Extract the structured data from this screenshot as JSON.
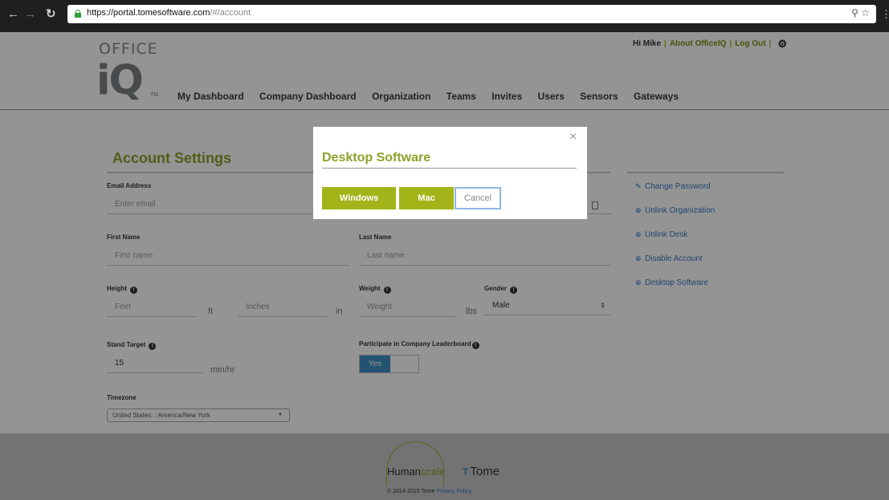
{
  "browser": {
    "url_host": "https://portal.tomesoftware.com",
    "url_path": "/#/account",
    "icons": [
      "back-icon",
      "forward-icon",
      "reload-icon",
      "lock-icon",
      "extension-icon",
      "star-icon",
      "menu-icon"
    ]
  },
  "header": {
    "logo_word": "OFFICE",
    "logo_mark": "iQ",
    "logo_tm": "TM",
    "greeting": "Hi Mike",
    "sep": "|",
    "about_label": "About OfficeIQ",
    "logout_label": "Log Out",
    "nav": [
      "My Dashboard",
      "Company Dashboard",
      "Organization",
      "Teams",
      "Invites",
      "Users",
      "Sensors",
      "Gateways"
    ]
  },
  "account": {
    "title": "Account Settings",
    "email_label": "Email Address",
    "email_placeholder": "Enter email",
    "first_name_label": "First Name",
    "first_name_placeholder": "First name",
    "last_name_label": "Last Name",
    "last_name_placeholder": "Last name",
    "height_label": "Height",
    "feet_placeholder": "Feet",
    "ft_unit": "ft",
    "inches_placeholder": "Inches",
    "in_unit": "in",
    "weight_label": "Weight",
    "weight_placeholder": "Weight",
    "lbs_unit": "lbs",
    "gender_label": "Gender",
    "gender_value": "Male",
    "stand_target_label": "Stand Target",
    "stand_target_value": "15",
    "stand_unit": "min/hr",
    "leaderboard_label": "Participate in Company Leaderboard",
    "leaderboard_value": "Yes",
    "timezone_label": "Timezone",
    "timezone_value": "United States: : America/New York"
  },
  "side_links": {
    "change_password": "Change Password",
    "unlink_org": "Unlink Organization",
    "unlink_desk": "Unlink Desk",
    "disable_account": "Disable Account",
    "desktop_software": "Desktop Software"
  },
  "modal": {
    "close": "×",
    "title": "Desktop Software",
    "windows_label": "Windows",
    "mac_label": "Mac",
    "cancel_label": "Cancel"
  },
  "footer": {
    "humanscale_a": "Human",
    "humanscale_b": "scale",
    "tome": "Tome",
    "tome_mark": "T",
    "copyright": "© 2014-2015 Tome",
    "privacy": "Privacy Policy"
  },
  "colors": {
    "accent_green": "#8fa12a",
    "button_green": "#a3b419",
    "link_blue": "#3578c0",
    "toggle_blue": "#3d8fc1"
  }
}
